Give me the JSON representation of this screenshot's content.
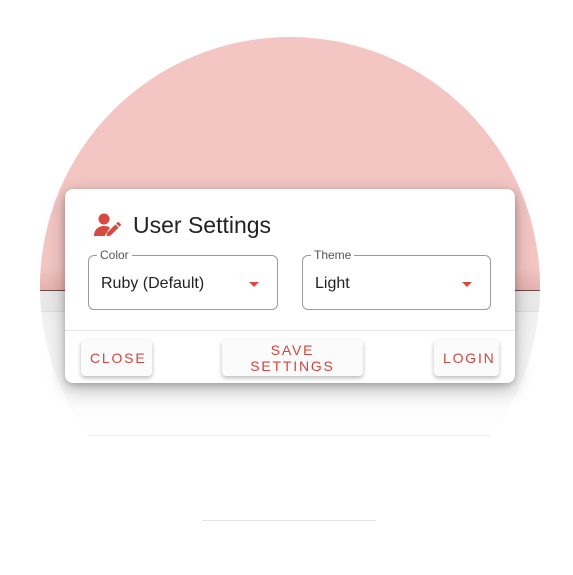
{
  "colors": {
    "accent": "#d9493f",
    "backdrop_top": "#f3c6c3",
    "dialog_bg": "#ffffff"
  },
  "dialog": {
    "icon": "user-edit-icon",
    "title": "User Settings",
    "color_field": {
      "label": "Color",
      "value": "Ruby (Default)"
    },
    "theme_field": {
      "label": "Theme",
      "value": "Light"
    },
    "actions": {
      "close": "CLOSE",
      "save": "SAVE SETTINGS",
      "login": "LOGIN"
    }
  }
}
